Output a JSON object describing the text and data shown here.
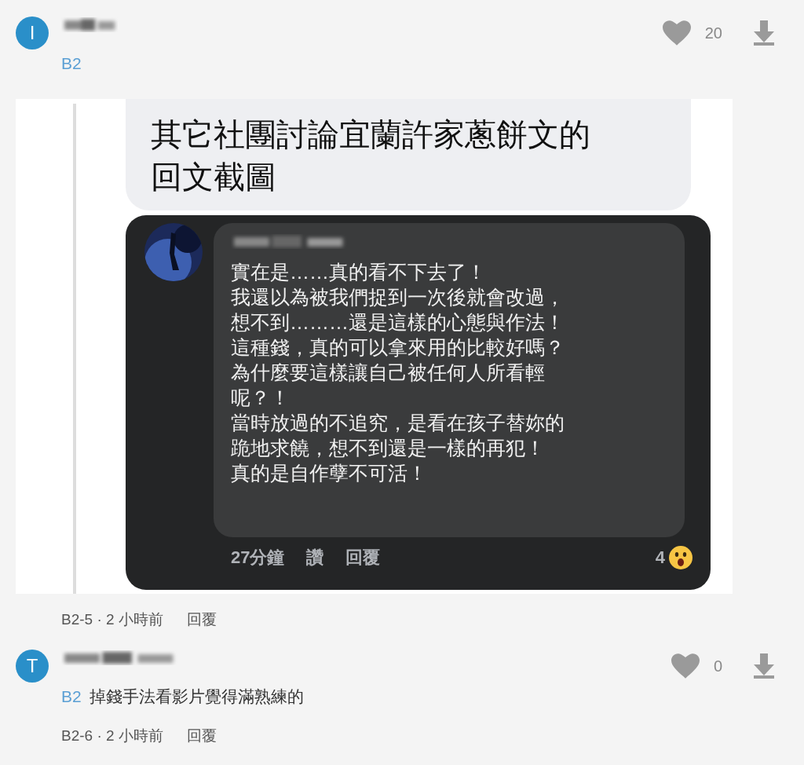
{
  "comments": [
    {
      "kind": "attachment",
      "avatar": "I",
      "reply_to": "B2",
      "likes": "20",
      "attachment": {
        "caption_lines": [
          "其它社團討論宜蘭許家蔥餅文的",
          "回文截圖"
        ],
        "post": {
          "lines": [
            "實在是……真的看不下去了！",
            "我還以為被我們捉到一次後就會改過，",
            "想不到………還是這樣的心態與作法！",
            "這種錢，真的可以拿來用的比較好嗎？",
            "為什麼要這樣讓自己被任何人所看輕",
            "呢？！",
            "當時放過的不追究，是看在孩子替妳的",
            "跪地求饒，想不到還是一樣的再犯！",
            "真的是自作孽不可活！"
          ],
          "time": "27分鐘",
          "actions": [
            "讚",
            "回覆"
          ],
          "reaction_count": "4"
        }
      },
      "meta": "B2-5 · 2 小時前",
      "reply_label": "回覆"
    },
    {
      "kind": "text",
      "avatar": "T",
      "reply_to": "B2",
      "text": "掉錢手法看影片覺得滿熟練的",
      "likes": "0",
      "meta": "B2-6 · 2 小時前",
      "reply_label": "回覆"
    }
  ]
}
